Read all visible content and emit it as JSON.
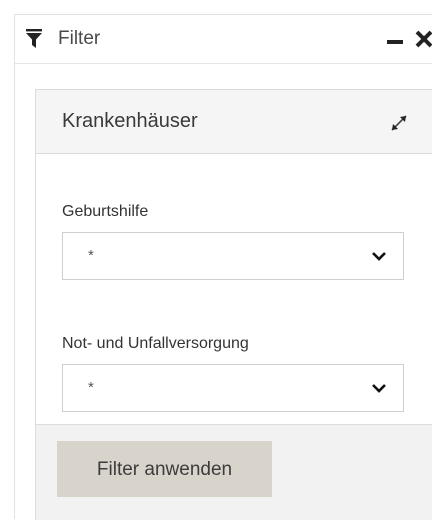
{
  "window": {
    "title": "Filter",
    "icons": [
      "funnel-icon",
      "minimize-icon",
      "close-icon"
    ]
  },
  "card": {
    "title": "Krankenhäuser",
    "icon": "expand-icon"
  },
  "fields": [
    {
      "label": "Geburtshilfe",
      "value": "*"
    },
    {
      "label": "Not- und Unfallversorgung",
      "value": "*"
    }
  ],
  "footer": {
    "apply_label": "Filter anwenden"
  },
  "colors": {
    "button_bg": "#d8d3cb",
    "header_bg": "#f5f5f5",
    "footer_bg": "#f2f2f2",
    "border": "#dcdcdc"
  }
}
